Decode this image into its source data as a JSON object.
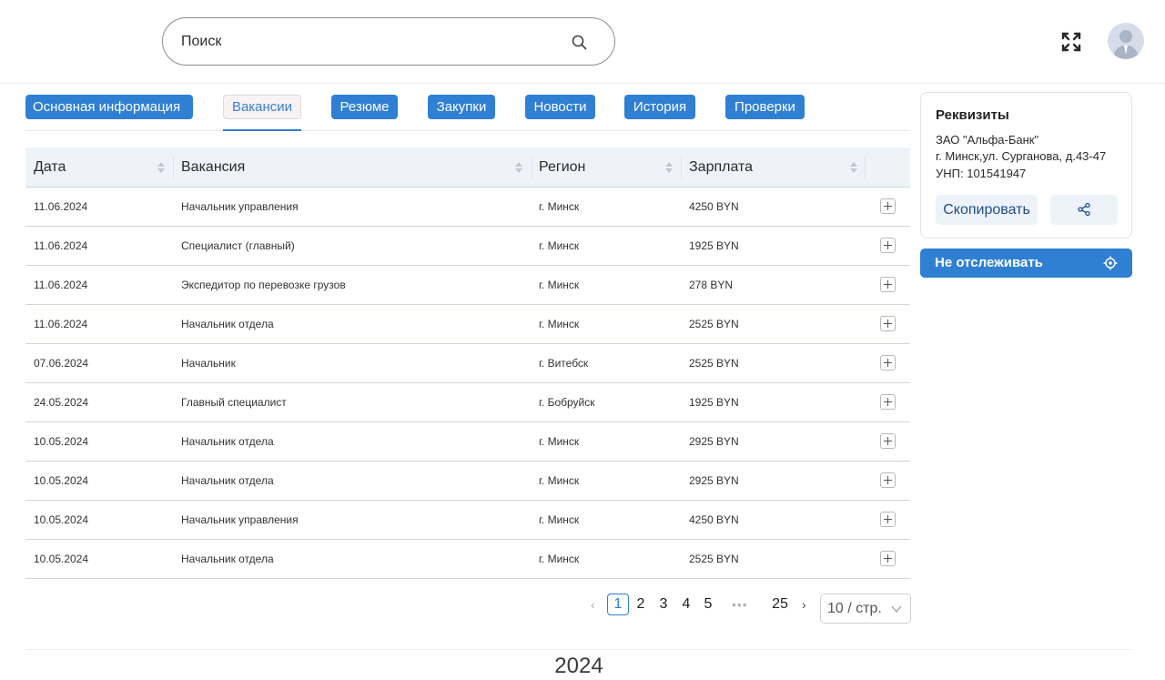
{
  "search": {
    "placeholder": "Поиск"
  },
  "tabs": [
    {
      "label": "Основная информация",
      "active": false
    },
    {
      "label": "Вакансии",
      "active": true
    },
    {
      "label": "Резюме",
      "active": false
    },
    {
      "label": "Закупки",
      "active": false
    },
    {
      "label": "Новости",
      "active": false
    },
    {
      "label": "История",
      "active": false
    },
    {
      "label": "Проверки",
      "active": false
    }
  ],
  "table": {
    "columns": [
      "Дата",
      "Вакансия",
      "Регион",
      "Зарплата"
    ],
    "rows": [
      {
        "date": "11.06.2024",
        "vacancy": "Начальник управления",
        "region": "г. Минск",
        "salary": "4250 BYN"
      },
      {
        "date": "11.06.2024",
        "vacancy": "Специалист (главный)",
        "region": "г. Минск",
        "salary": "1925 BYN"
      },
      {
        "date": "11.06.2024",
        "vacancy": "Экспедитор по перевозке грузов",
        "region": "г. Минск",
        "salary": "278 BYN"
      },
      {
        "date": "11.06.2024",
        "vacancy": "Начальник отдела",
        "region": "г. Минск",
        "salary": "2525 BYN"
      },
      {
        "date": "07.06.2024",
        "vacancy": "Начальник",
        "region": "г. Витебск",
        "salary": "2525 BYN"
      },
      {
        "date": "24.05.2024",
        "vacancy": "Главный специалист",
        "region": "г. Бобруйск",
        "salary": "1925 BYN"
      },
      {
        "date": "10.05.2024",
        "vacancy": "Начальник отдела",
        "region": "г. Минск",
        "salary": "2925 BYN"
      },
      {
        "date": "10.05.2024",
        "vacancy": "Начальник отдела",
        "region": "г. Минск",
        "salary": "2925 BYN"
      },
      {
        "date": "10.05.2024",
        "vacancy": "Начальник управления",
        "region": "г. Минск",
        "salary": "4250 BYN"
      },
      {
        "date": "10.05.2024",
        "vacancy": "Начальник отдела",
        "region": "г. Минск",
        "salary": "2525 BYN"
      }
    ]
  },
  "pagination": {
    "pages": [
      "1",
      "2",
      "3",
      "4",
      "5"
    ],
    "current": "1",
    "ellipsis": "•••",
    "last": "25",
    "page_size": "10 / стр.",
    "prev": "‹",
    "next": "›"
  },
  "requisites": {
    "title": "Реквизиты",
    "company": "ЗАО \"Альфа-Банк\"",
    "address": "г. Минск,ул. Сурганова, д.43-47",
    "unp": "УНП: 101541947",
    "copy_label": "Скопировать"
  },
  "track": {
    "label": "Не отслеживать"
  },
  "footer": {
    "year": "2024"
  },
  "colors": {
    "accent": "#2f7fd3",
    "header_bg": "#eff3f9",
    "row_border": "#cfd6df"
  },
  "icons": {
    "search": "search-icon",
    "fullscreen": "fullscreen-icon",
    "avatar": "user-avatar-icon",
    "sort": "sort-icon",
    "expand": "plus-square-icon",
    "share": "share-icon",
    "track": "target-icon"
  }
}
